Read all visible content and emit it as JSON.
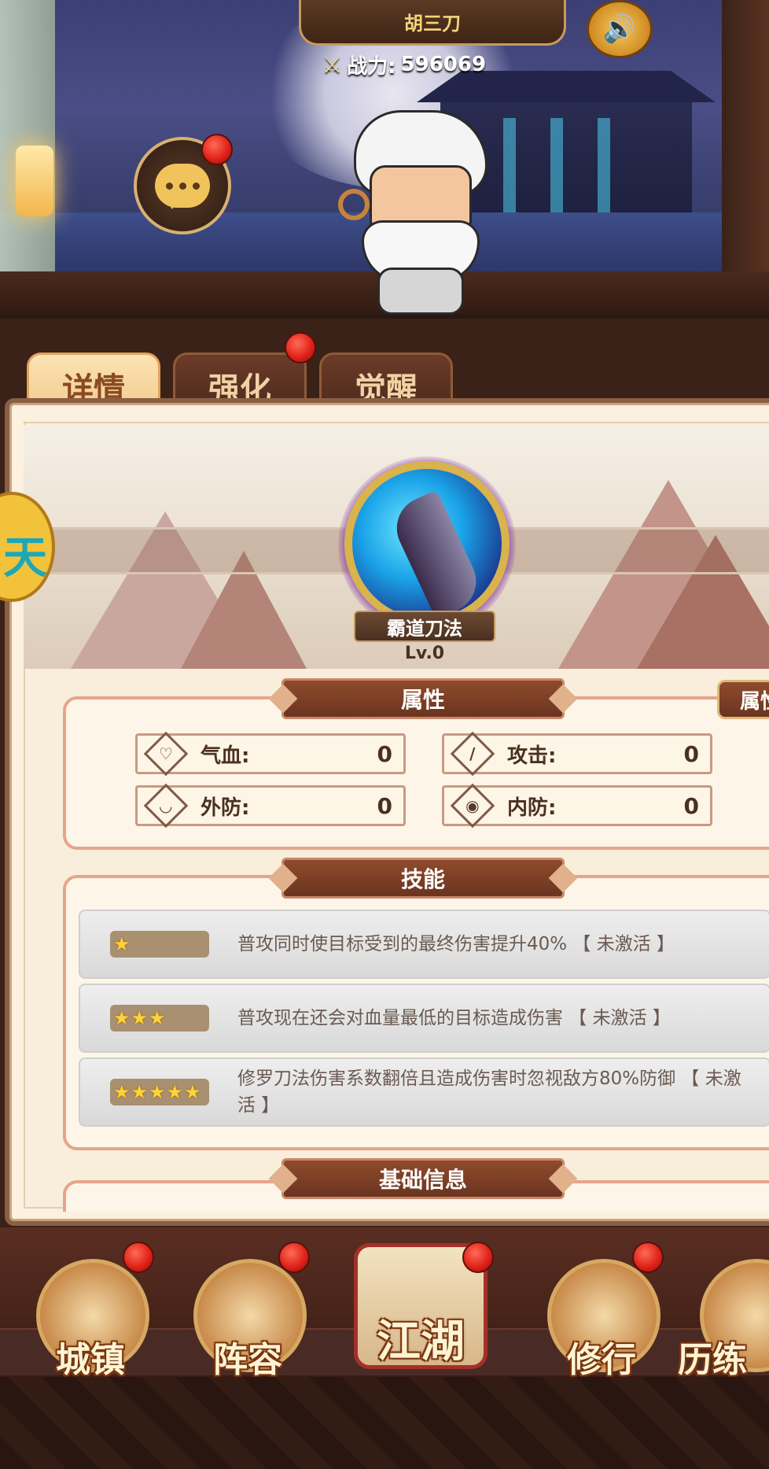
{
  "hero": {
    "name": "胡三刀",
    "power_label": "战力:",
    "power_value": "596069"
  },
  "icons": {
    "sound": "speaker-icon",
    "chat": "chat-bubble-icon",
    "power": "crossed-swords-icon"
  },
  "tabs": [
    {
      "label": "详情",
      "active": true
    },
    {
      "label": "强化",
      "active": false,
      "badge": true
    },
    {
      "label": "觉醒",
      "active": false
    }
  ],
  "skill": {
    "name": "霸道刀法",
    "level": "Lv.0"
  },
  "attributes": {
    "title": "属性",
    "side_tab": "属性",
    "items": [
      {
        "icon": "heart-icon",
        "label": "气血:",
        "value": "0"
      },
      {
        "icon": "sword-icon",
        "label": "攻击:",
        "value": "0"
      },
      {
        "icon": "shield-icon",
        "label": "外防:",
        "value": "0"
      },
      {
        "icon": "flame-icon",
        "label": "内防:",
        "value": "0"
      }
    ]
  },
  "skills": {
    "title": "技能",
    "rows": [
      {
        "stars": 1,
        "text": "普攻同时使目标受到的最终伤害提升40% 【 未激活 】"
      },
      {
        "stars": 3,
        "text": "普攻现在还会对血量最低的目标造成伤害 【 未激活 】"
      },
      {
        "stars": 5,
        "text": "修罗刀法伤害系数翻倍且造成伤害时忽视敌方80%防御 【 未激活 】"
      }
    ]
  },
  "basic_info": {
    "title": "基础信息"
  },
  "nav": [
    {
      "label": "城镇",
      "badge": true
    },
    {
      "label": "阵容",
      "badge": true
    },
    {
      "label": "江湖",
      "badge": true
    },
    {
      "label": "修行",
      "badge": true
    },
    {
      "label": "历练",
      "badge": false
    }
  ],
  "colors": {
    "accent": "#f2c98a",
    "badge": "#e0231a",
    "panel": "#fbf1de",
    "title_bar": "#8f4b2c"
  }
}
